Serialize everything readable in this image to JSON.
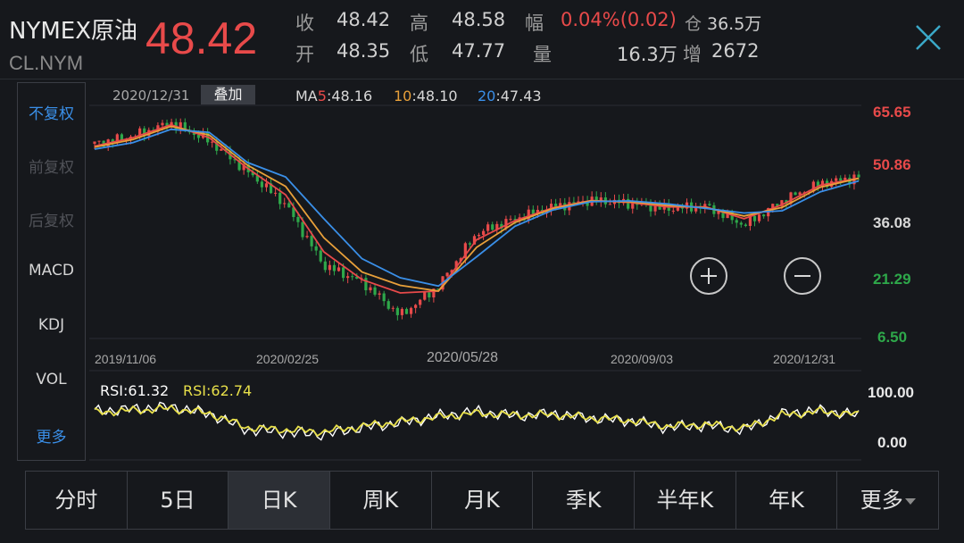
{
  "header": {
    "name": "NYMEX原油",
    "code": "CL.NYM",
    "price": "48.42",
    "quote": {
      "close_label": "收",
      "close_value": "48.42",
      "high_label": "高",
      "high_value": "48.58",
      "change_label": "幅",
      "change_value": "0.04%(0.02)",
      "oi_label": "仓",
      "oi_value": "36.5万",
      "open_label": "开",
      "open_value": "48.35",
      "low_label": "低",
      "low_value": "47.77",
      "volume_label": "量",
      "volume_value": "16.3万",
      "increase_label": "增",
      "increase_value": "2672"
    }
  },
  "side_menu": [
    {
      "label": "不复权",
      "state": "active"
    },
    {
      "label": "前复权",
      "state": "disabled"
    },
    {
      "label": "后复权",
      "state": "disabled"
    },
    {
      "label": "MACD",
      "state": "normal"
    },
    {
      "label": "KDJ",
      "state": "normal"
    },
    {
      "label": "VOL",
      "state": "normal"
    },
    {
      "label": "更多",
      "state": "link"
    }
  ],
  "chart": {
    "date_label": "2020/12/31",
    "overlay_button": "叠加",
    "ma": [
      {
        "label": "MA5",
        "value": ":48.16",
        "color": "#e84a4a"
      },
      {
        "label": "10",
        "value": ":48.10",
        "color": "#e8a03a"
      },
      {
        "label": "20",
        "value": ":47.43",
        "color": "#3a8fe8"
      }
    ],
    "y_labels": [
      {
        "text": "65.65",
        "color": "#e84a4a"
      },
      {
        "text": "50.86",
        "color": "#e84a4a"
      },
      {
        "text": "36.08",
        "color": "#d8d8d8"
      },
      {
        "text": "21.29",
        "color": "#2ea84a"
      },
      {
        "text": "6.50",
        "color": "#2ea84a"
      }
    ],
    "x_labels": [
      "2019/11/06",
      "2020/02/25",
      "2020/05/28",
      "2020/09/03",
      "2020/12/31"
    ],
    "rsi": [
      {
        "label": "RSI:61.32",
        "color": "#ffffff"
      },
      {
        "label": "RSI:62.74",
        "color": "#e8e04a"
      }
    ],
    "rsi_y_labels": [
      "100.00",
      "0.00"
    ]
  },
  "tabs": [
    {
      "label": "分时"
    },
    {
      "label": "5日"
    },
    {
      "label": "日K",
      "active": true
    },
    {
      "label": "周K"
    },
    {
      "label": "月K"
    },
    {
      "label": "季K"
    },
    {
      "label": "半年K"
    },
    {
      "label": "年K"
    },
    {
      "label": "更多",
      "dropdown": true
    }
  ],
  "chart_data": {
    "type": "candlestick",
    "instrument": "NYMEX原油",
    "x_range": [
      "2019/11/06",
      "2020/12/31"
    ],
    "x": [
      "2019/11/06",
      "2019/12/10",
      "2020/01/06",
      "2020/01/20",
      "2020/02/25",
      "2020/03/09",
      "2020/03/20",
      "2020/04/01",
      "2020/04/20",
      "2020/05/01",
      "2020/05/28",
      "2020/06/15",
      "2020/07/15",
      "2020/08/15",
      "2020/09/03",
      "2020/09/20",
      "2020/10/15",
      "2020/11/02",
      "2020/11/20",
      "2020/12/10",
      "2020/12/31"
    ],
    "close": [
      57.2,
      59.2,
      62.7,
      58.0,
      49.9,
      41.3,
      25.2,
      21.0,
      12.0,
      19.8,
      33.7,
      37.5,
      40.6,
      42.4,
      41.5,
      40.1,
      40.8,
      35.8,
      42.2,
      46.8,
      48.42
    ],
    "series": [
      {
        "name": "MA5",
        "values": [
          56.6,
          58.8,
          62.2,
          58.8,
          50.8,
          43.8,
          28.8,
          21.5,
          18.0,
          18.5,
          32.0,
          37.0,
          40.4,
          42.3,
          41.8,
          40.6,
          40.6,
          37.5,
          41.2,
          46.3,
          48.16
        ]
      },
      {
        "name": "10",
        "values": [
          56.3,
          58.3,
          61.8,
          59.5,
          51.6,
          46.0,
          32.5,
          23.5,
          20.0,
          18.5,
          30.0,
          36.5,
          40.2,
          42.2,
          42.0,
          41.0,
          40.4,
          38.2,
          40.5,
          45.8,
          48.1
        ]
      },
      {
        "name": "20",
        "values": [
          55.8,
          57.5,
          61.0,
          60.2,
          52.3,
          48.5,
          37.5,
          27.0,
          22.0,
          19.8,
          27.5,
          35.5,
          39.8,
          42.0,
          42.2,
          41.4,
          40.2,
          39.0,
          39.6,
          44.6,
          47.43
        ]
      }
    ],
    "y_ticks": [
      65.65,
      50.86,
      36.08,
      21.29,
      6.5
    ],
    "ylim": [
      6.5,
      65.65
    ],
    "rsi": {
      "ylim": [
        0,
        100
      ],
      "series": [
        {
          "name": "RSI",
          "values": [
            70,
            75,
            80,
            65,
            30,
            25,
            20,
            35,
            45,
            60,
            70,
            60,
            65,
            55,
            50,
            35,
            40,
            30,
            65,
            72,
            61.32
          ]
        },
        {
          "name": "RSI",
          "values": [
            68,
            72,
            76,
            66,
            35,
            30,
            26,
            38,
            48,
            58,
            66,
            62,
            63,
            56,
            51,
            38,
            42,
            34,
            62,
            70,
            62.74
          ]
        }
      ]
    }
  }
}
